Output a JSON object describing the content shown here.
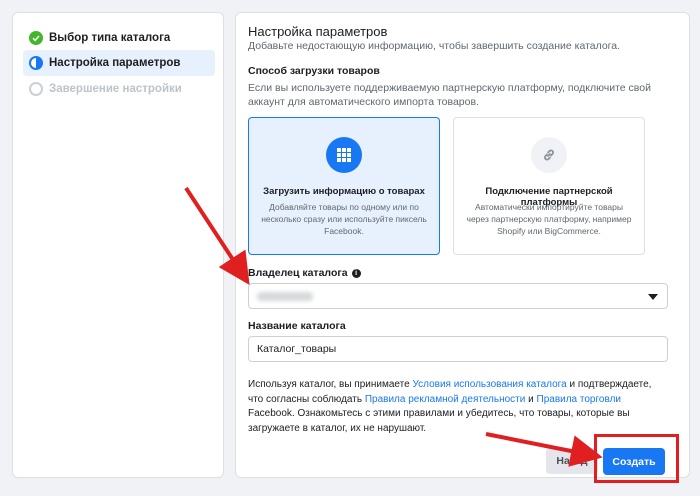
{
  "sidebar": {
    "steps": [
      {
        "label": "Выбор типа каталога",
        "state": "done"
      },
      {
        "label": "Настройка параметров",
        "state": "active"
      },
      {
        "label": "Завершение настройки",
        "state": "pending"
      }
    ]
  },
  "main": {
    "title": "Настройка параметров",
    "subtitle": "Добавьте недостающую информацию, чтобы завершить создание каталога.",
    "upload_section": {
      "title": "Способ загрузки товаров",
      "description": "Если вы используете поддерживаемую партнерскую платформу, подключите свой аккаунт для автоматического импорта товаров."
    },
    "cards": [
      {
        "title": "Загрузить информацию о товарах",
        "description": "Добавляйте товары по одному или по несколько сразу или используйте пиксель Facebook.",
        "icon": "grid-icon",
        "selected": true
      },
      {
        "title": "Подключение партнерской платформы",
        "description": "Автоматически импортируйте товары через партнерскую платформу, например Shopify или BigCommerce.",
        "icon": "link-icon",
        "selected": false
      }
    ],
    "owner": {
      "label": "Владелец каталога",
      "info_icon": "i"
    },
    "catalog_name": {
      "label": "Название каталога",
      "value": "Каталог_товары"
    },
    "terms": {
      "p1": "Используя каталог, вы принимаете ",
      "link1": "Условия использования каталога",
      "p2": " и подтверждаете, что согласны соблюдать ",
      "link2": "Правила рекламной деятельности",
      "p3": " и ",
      "link3": "Правила торговли",
      "p4": " Facebook. Ознакомьтесь с этими правилами и убедитесь, что товары, которые вы загружаете в каталог, их не нарушают."
    },
    "buttons": {
      "back": "Назад",
      "create": "Создать"
    }
  },
  "colors": {
    "accent": "#1877f2",
    "success": "#42b72a",
    "annotation": "#e02020"
  }
}
